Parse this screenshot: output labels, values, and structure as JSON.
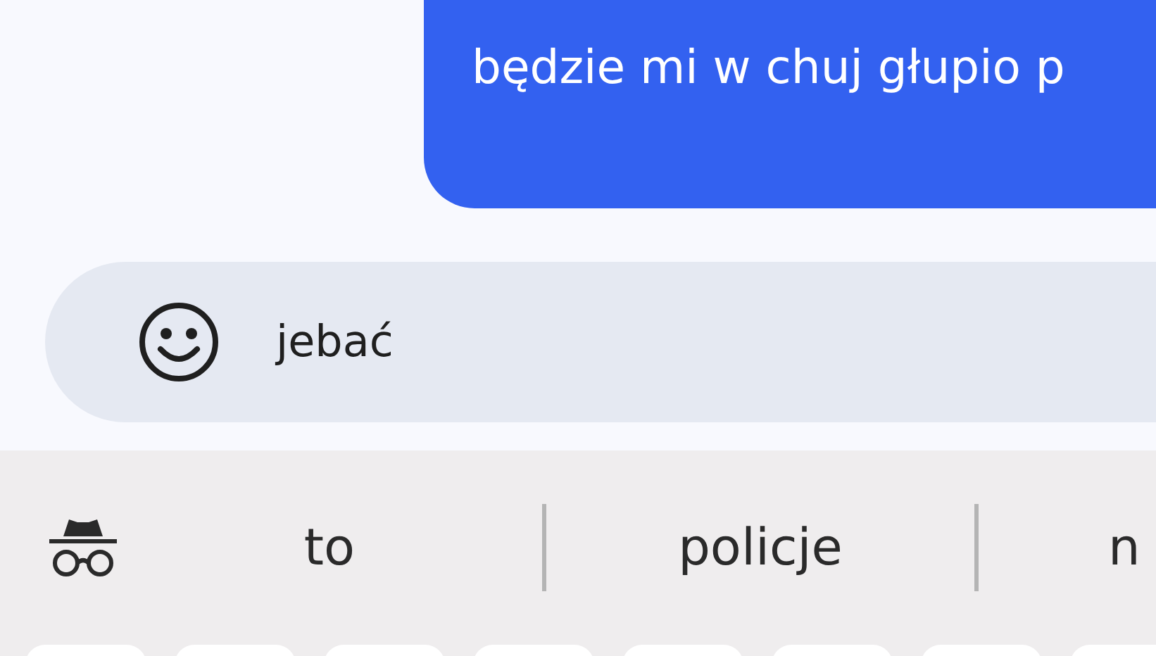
{
  "message": {
    "text": "będzie mi w chuj głupio p",
    "outgoing": true
  },
  "compose": {
    "value": "jebać"
  },
  "suggestions": [
    {
      "text": "to"
    },
    {
      "text": "policje"
    },
    {
      "text": "n"
    }
  ]
}
